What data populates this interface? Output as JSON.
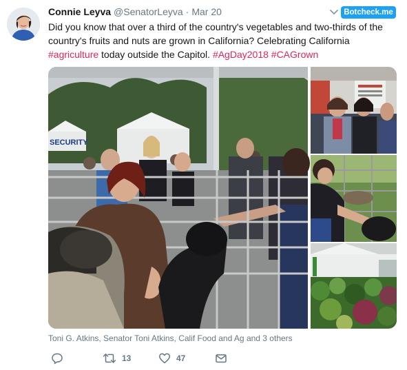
{
  "author": {
    "name": "Connie Leyva",
    "handle": "@SenatorLeyva",
    "separator": "·",
    "time": "Mar 20"
  },
  "badge": {
    "label": "Botcheck.me"
  },
  "tweet": {
    "line1": "Did you know that over a third of the country's vegetables and two-thirds of the",
    "line2": "country's fruits and nuts are grown in California? Celebrating California",
    "line3_tag1": "#agriculture",
    "line3_text": " today outside the Capitol. ",
    "line3_tag2": "#AgDay2018",
    "line3_space": " ",
    "line3_tag3": "#CAGrown"
  },
  "media": {
    "photo_count": 4,
    "sign_text": "SECURITY"
  },
  "tagged_people": "Toni G. Atkins, Senator Toni Atkins, Calif Food and Ag and 3 others",
  "actions": {
    "reply": {
      "icon": "reply-icon"
    },
    "retweet": {
      "icon": "retweet-icon",
      "count": "13"
    },
    "like": {
      "icon": "heart-icon",
      "count": "47"
    },
    "dm": {
      "icon": "envelope-icon"
    }
  },
  "colors": {
    "hashtag": "#e0245e",
    "badge": "#1da1f2",
    "secondary_text": "#657786",
    "primary_text": "#14171a"
  }
}
